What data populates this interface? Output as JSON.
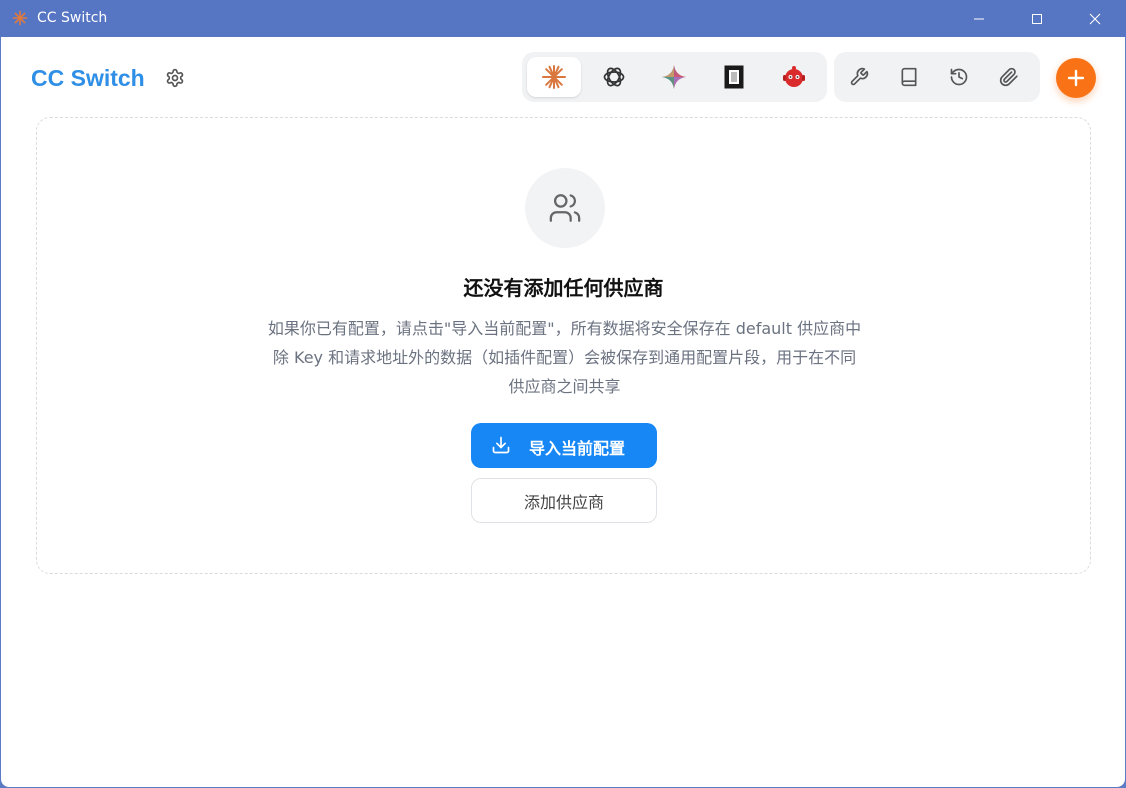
{
  "window": {
    "title": "CC Switch",
    "controls": {
      "minimize": "minimize-icon",
      "maximize": "maximize-icon",
      "close": "close-icon"
    }
  },
  "header": {
    "brand": "CC Switch",
    "settings_icon": "gear-icon",
    "apps": [
      {
        "icon": "claude-icon",
        "active": true
      },
      {
        "icon": "openai-icon",
        "active": false
      },
      {
        "icon": "gemini-icon",
        "active": false
      },
      {
        "icon": "terminal-app-icon",
        "active": false
      },
      {
        "icon": "robot-icon",
        "active": false
      }
    ],
    "tools": [
      "wrench-icon",
      "book-icon",
      "history-icon",
      "paperclip-icon"
    ],
    "add_icon": "plus-icon"
  },
  "empty_state": {
    "icon": "users-icon",
    "title": "还没有添加任何供应商",
    "description_lines": [
      "如果你已有配置，请点击\"导入当前配置\"，所有数据将安全保存在 default 供应商中",
      "除 Key 和请求地址外的数据（如插件配置）会被保存到通用配置片段，用于在不同",
      "供应商之间共享"
    ],
    "import_button": "导入当前配置",
    "add_button": "添加供应商"
  },
  "colors": {
    "titlebar": "#5676c3",
    "brand": "#2f8fe6",
    "primary": "#1687f5",
    "accent": "#f97316"
  }
}
